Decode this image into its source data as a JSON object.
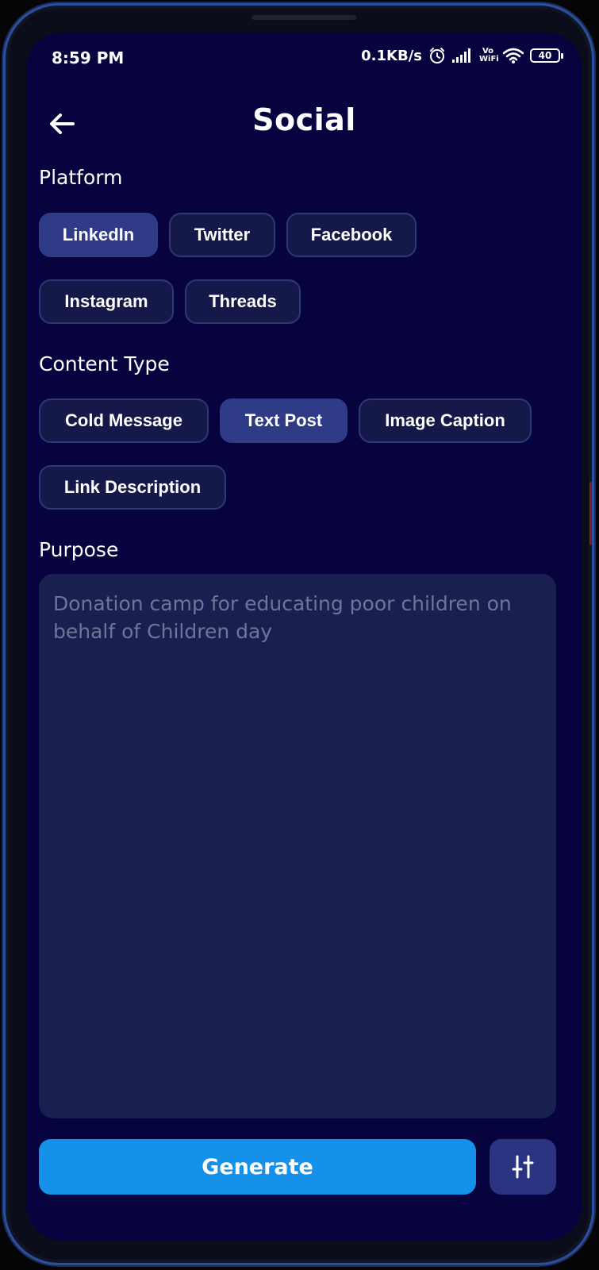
{
  "status_bar": {
    "time": "8:59 PM",
    "net_speed": "0.1KB/s",
    "vowifi_top": "Vo",
    "vowifi_bottom": "WiFi",
    "battery": "40"
  },
  "header": {
    "title": "Social",
    "back_icon": "arrow-left-icon"
  },
  "platform": {
    "label": "Platform",
    "options": [
      "LinkedIn",
      "Twitter",
      "Facebook",
      "Instagram",
      "Threads"
    ],
    "selected": "LinkedIn"
  },
  "content_type": {
    "label": "Content Type",
    "options": [
      "Cold Message",
      "Text Post",
      "Image Caption",
      "Link Description"
    ],
    "selected": "Text Post"
  },
  "purpose": {
    "label": "Purpose",
    "placeholder": "Donation camp for educating poor children on behalf of Children day"
  },
  "actions": {
    "generate_label": "Generate",
    "settings_icon": "sliders-icon"
  },
  "colors": {
    "background": "#06033f",
    "chip": "#15194a",
    "chip_selected": "#2f3b86",
    "input": "#19204f",
    "accent": "#1691ea"
  }
}
